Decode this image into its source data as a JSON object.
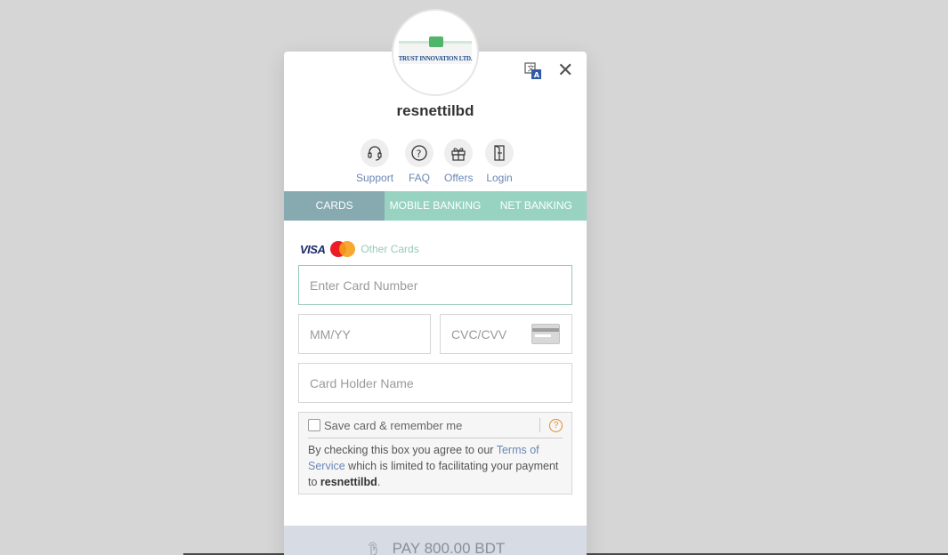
{
  "merchant": {
    "name": "resnettilbd",
    "logo_text": "TRUST INNOVATION LTD."
  },
  "quick_links": [
    {
      "label": "Support",
      "icon": "headset-icon"
    },
    {
      "label": "FAQ",
      "icon": "question-icon"
    },
    {
      "label": "Offers",
      "icon": "gift-icon"
    },
    {
      "label": "Login",
      "icon": "login-icon"
    }
  ],
  "tabs": [
    {
      "label": "CARDS",
      "active": true
    },
    {
      "label": "MOBILE BANKING",
      "active": false
    },
    {
      "label": "NET BANKING",
      "active": false
    }
  ],
  "card_brands": {
    "visa": "VISA",
    "other": "Other Cards"
  },
  "form": {
    "card_number_placeholder": "Enter Card Number",
    "expiry_placeholder": "MM/YY",
    "cvc_placeholder": "CVC/CVV",
    "holder_placeholder": "Card Holder Name"
  },
  "save_card": {
    "label": "Save card & remember me",
    "help": "?",
    "text_prefix": "By checking this box you agree to our ",
    "terms_link": "Terms of Service",
    "text_mid": " which is limited to facilitating your payment to ",
    "merchant": "resnettilbd",
    "text_suffix": "."
  },
  "pay_button": {
    "label": "PAY 800.00 BDT"
  },
  "colors": {
    "tab_bg": "#98d3c2",
    "tab_active": "#86aab0",
    "link": "#6b88b5",
    "pay_bg": "#d7dce4"
  }
}
